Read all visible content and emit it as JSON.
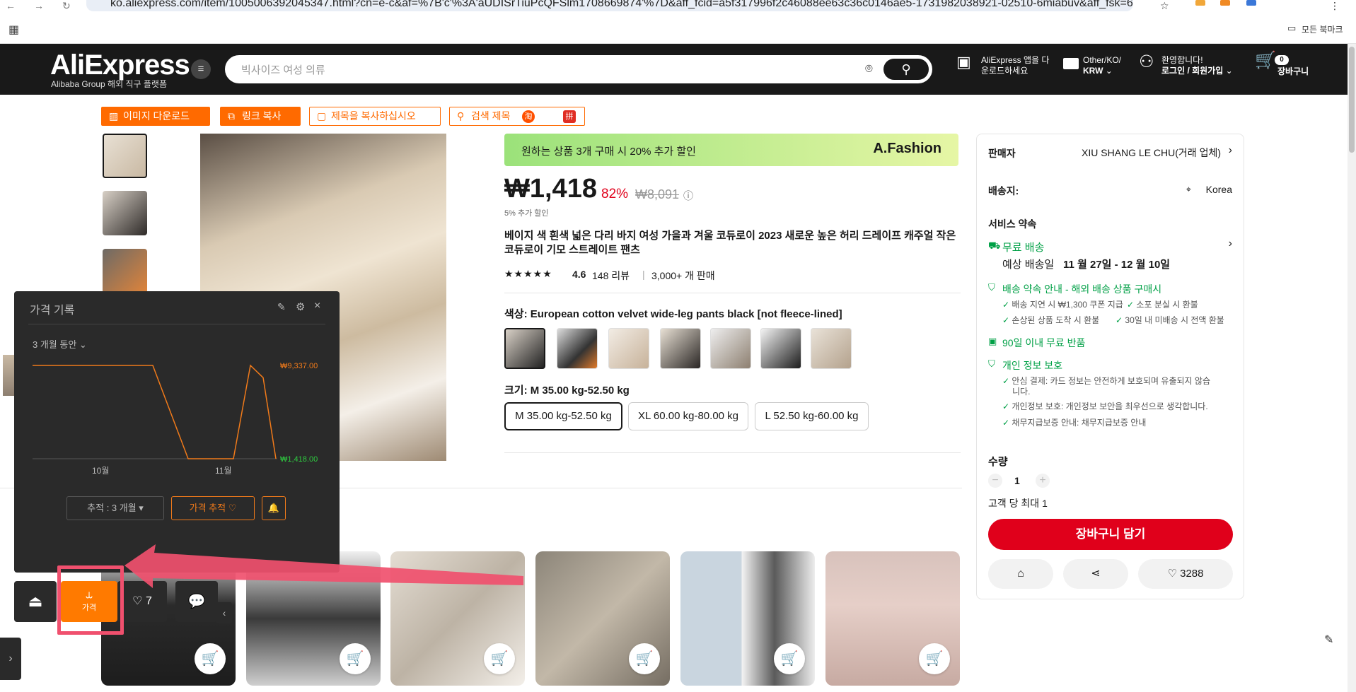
{
  "browser": {
    "url": "ko.aliexpress.com/item/1005006392045347.html?cn=e-c&af=%7B'c'%3A'aUDISrTiuPcQFSlm1708669874'%7D&aff_fcid=a5f317996f2c46088ee63c36c0146ae5-1731982038921-02510-6miabuv&aff_fsk=6miabuv&a...",
    "bookmarks_all": "모든 북마크"
  },
  "header": {
    "logo": "AliExpress",
    "logo_sub": "Alibaba Group 해외 직구 플랫폼",
    "search_placeholder": "빅사이즈 여성 의류",
    "app_line1": "AliExpress 앱을 다",
    "app_line2": "운로드하세요",
    "locale_line1": "Other/KO/",
    "locale_line2": "KRW",
    "welcome_line1": "환영합니다!",
    "welcome_line2": "로그인 / 회원가입",
    "cart_label": "장바구니",
    "cart_count": "0"
  },
  "toolbar": {
    "download_image": "이미지 다운로드",
    "copy_link": "링크 복사",
    "copy_title": "제목을 복사하십시오",
    "search_title": "검색 제목",
    "search_badge1": "淘",
    "search_badge2": "拼"
  },
  "product": {
    "banner_text": "원하는 상품 3개 구매 시 20% 추가 할인",
    "banner_brand": "A.Fashion",
    "price": "₩1,418",
    "discount": "82%",
    "original_price": "₩8,091",
    "extra_discount": "5% 추가 할인",
    "title": "베이지 색 흰색 넓은 다리 바지 여성 가을과 겨울 코듀로이 2023 새로운 높은 허리 드레이프 캐주얼 작은 코듀로이 기모 스트레이트 팬츠",
    "rating": "4.6",
    "reviews": "148 리뷰",
    "sold": "3,000+ 개 판매",
    "color_label": "색상: European cotton velvet wide-leg pants black [not fleece-lined]",
    "size_label": "크기: M 35.00 kg-52.50 kg",
    "sizes": [
      "M 35.00 kg-52.50 kg",
      "XL 60.00 kg-80.00 kg",
      "L 52.50 kg-60.00 kg"
    ]
  },
  "seller_panel": {
    "seller_label": "판매자",
    "seller_name": "XIU SHANG LE CHU(거래 업체)",
    "ship_to_label": "배송지:",
    "ship_to": "Korea",
    "service_title": "서비스 약속",
    "free_shipping": "무료 배송",
    "delivery_est": "예상 배송일",
    "delivery_dates": "11 월 27일 - 12 월 10일",
    "shipping_promise": "배송 약속 안내 - 해외 배송 상품 구매시",
    "promise_items": [
      "배송 지연 시 ₩1,300 쿠폰 지급",
      "소포 분실 시 환불",
      "손상된 상품 도착 시 환불",
      "30일 내 미배송 시 전액 환불"
    ],
    "free_return": "90일 이내 무료 반품",
    "privacy_title": "개인 정보 보호",
    "privacy_items": [
      "안심 결제: 카드 정보는 안전하게 보호되며 유출되지 않습",
      "니다.",
      "개인정보 보호: 개인정보 보안을 최우선으로 생각합니다.",
      "채무지급보증 안내: 채무지급보증 안내"
    ],
    "qty_label": "수량",
    "qty_value": "1",
    "qty_limit": "고객 당 최대 1",
    "add_to_cart": "장바구니 담기",
    "wishlist_count": "3288"
  },
  "price_history": {
    "title": "가격 기록",
    "period": "3 개월 동안",
    "max_price": "₩9,337.00",
    "min_price": "₩1,418.00",
    "x_labels": [
      "10월",
      "11월"
    ],
    "track_period": "추적 : 3 개월",
    "track_button": "가격 추적"
  },
  "chart_data": {
    "type": "line",
    "title": "가격 기록",
    "xlabel": "",
    "ylabel": "",
    "x_ticks": [
      "10월",
      "11월"
    ],
    "ylim": [
      1418,
      9337
    ],
    "series": [
      {
        "values": [
          9337,
          9337,
          9337,
          9337,
          1418,
          1418,
          1418,
          9337,
          8300,
          1418
        ]
      }
    ],
    "grid": false,
    "colors": {
      "line": "#f07a1a",
      "max_label": "#f07a1a",
      "min_label": "#2ecc40"
    }
  },
  "floating_bar": {
    "price_label": "가격",
    "likes": "7"
  },
  "colors": {
    "accent": "#ff6a00",
    "brand_red": "#e0001b",
    "green": "#00a046",
    "annotation": "#f0506e"
  }
}
